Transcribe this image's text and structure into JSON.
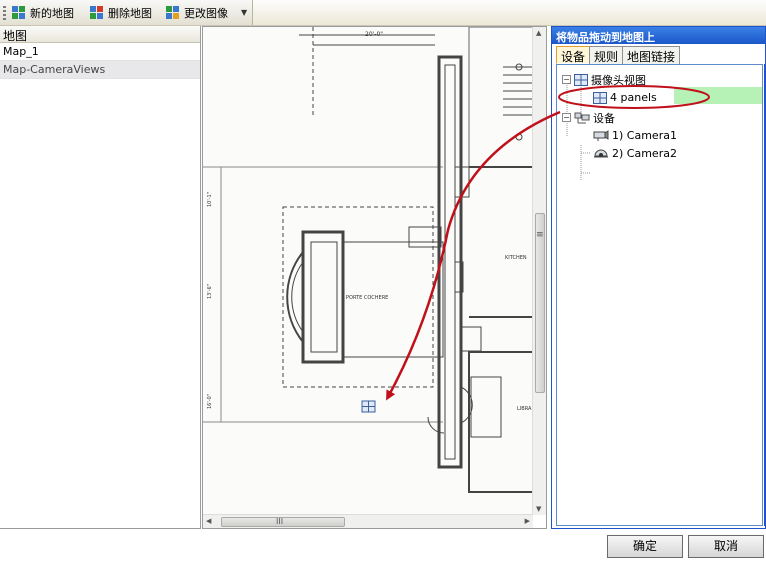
{
  "toolbar": {
    "new_map": "新的地图",
    "delete_map": "删除地图",
    "change_image": "更改图像"
  },
  "left_panel": {
    "header": "地图",
    "items": [
      "Map_1",
      "Map-CameraViews"
    ]
  },
  "floorplan": {
    "dimension": "20'-0\"",
    "kitchen": "KITCHEN",
    "porte_cochere": "PORTE COCHERE",
    "library": "LIBRA",
    "scale_a": "10'-1\"",
    "scale_b": "13'-6\"",
    "scale_c": "16'-0\""
  },
  "scrollbar": {
    "h_thumb_grip": "III",
    "v_thumb_grip": "≡"
  },
  "right_panel": {
    "title": "将物品拖动到地图上",
    "tabs": [
      "设备",
      "规则",
      "地图链接"
    ],
    "tree": {
      "camera_views": "摄像头视图",
      "four_panels": "4 panels",
      "devices": "设备",
      "camera1": "1) Camera1",
      "camera2": "2) Camera2"
    }
  },
  "buttons": {
    "ok": "确定",
    "cancel": "取消"
  },
  "colors": {
    "title_bar": "#1b57c8",
    "highlight": "#b6f2b6",
    "arrow": "#c0101a",
    "tab_active_border": "#e59c2c"
  }
}
